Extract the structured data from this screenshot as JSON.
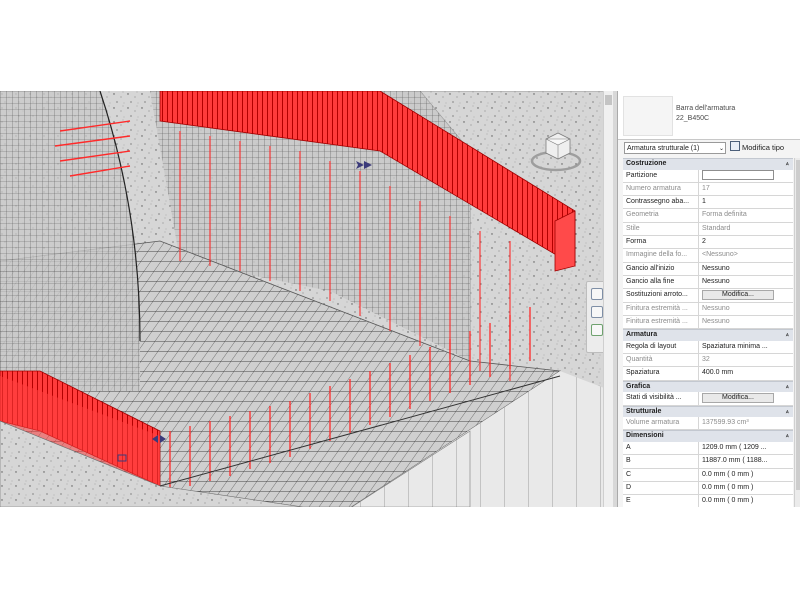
{
  "type_selector": {
    "name": "Barra dell'armatura",
    "subtype": "22_B450C"
  },
  "instance_filter": "Armatura strutturale (1)",
  "edit_type_label": "Modifica tipo",
  "collapse_glyph": "⩓",
  "dropdown_glyph": "⌄",
  "sections": [
    {
      "title": "Costruzione",
      "rows": [
        {
          "key": "Partizione",
          "value": "",
          "readonly": false,
          "control": "box"
        },
        {
          "key": "Numero armatura",
          "value": "17",
          "readonly": true
        },
        {
          "key": "Contrassegno aba...",
          "value": "1",
          "readonly": false
        },
        {
          "key": "Geometria",
          "value": "Forma definita",
          "readonly": true
        },
        {
          "key": "Stile",
          "value": "Standard",
          "readonly": true
        },
        {
          "key": "Forma",
          "value": "2",
          "readonly": false
        },
        {
          "key": "Immagine della fo...",
          "value": "<Nessuno>",
          "readonly": true
        },
        {
          "key": "Gancio all'inizio",
          "value": "Nessuno",
          "readonly": false
        },
        {
          "key": "Gancio alla fine",
          "value": "Nessuno",
          "readonly": false
        },
        {
          "key": "Sostituzioni arroto...",
          "value": "Modifica...",
          "readonly": false,
          "control": "button"
        },
        {
          "key": "Finitura estremità ...",
          "value": "Nessuno",
          "readonly": true
        },
        {
          "key": "Finitura estremità ...",
          "value": "Nessuno",
          "readonly": true
        }
      ]
    },
    {
      "title": "Armatura",
      "rows": [
        {
          "key": "Regola di layout",
          "value": "Spaziatura minima ...",
          "readonly": false,
          "control": "dropdown"
        },
        {
          "key": "Quantità",
          "value": "32",
          "readonly": true
        },
        {
          "key": "Spaziatura",
          "value": "400.0 mm",
          "readonly": false
        }
      ]
    },
    {
      "title": "Grafica",
      "rows": [
        {
          "key": "Stati di visibilità ...",
          "value": "Modifica...",
          "readonly": false,
          "control": "button"
        }
      ]
    },
    {
      "title": "Strutturale",
      "rows": [
        {
          "key": "Volume armatura",
          "value": "137599.93 cm³",
          "readonly": true
        }
      ]
    },
    {
      "title": "Dimensioni",
      "rows": [
        {
          "key": "A",
          "value": "1209.0 mm ( 1209 ...",
          "readonly": false
        },
        {
          "key": "B",
          "value": "11887.0 mm ( 1188...",
          "readonly": false
        },
        {
          "key": "C",
          "value": "0.0 mm ( 0 mm )",
          "readonly": false
        },
        {
          "key": "D",
          "value": "0.0 mm ( 0 mm )",
          "readonly": false
        },
        {
          "key": "E",
          "value": "0.0 mm ( 0 mm )",
          "readonly": false
        },
        {
          "key": "F",
          "value": "0.0 mm ( 0 mm )",
          "readonly": false
        }
      ]
    }
  ],
  "colors": {
    "rebar_highlight": "#ff1f1f",
    "rebar_mesh": "#3a3a3a",
    "concrete": "#d8d8d8",
    "panel_header": "#dfe3ea",
    "grip_marker": "#3b3a7a"
  },
  "viewport": {
    "icons": [
      "viewcube-icon",
      "steering-wheel-icon",
      "zoom-icon",
      "pan-icon"
    ]
  }
}
